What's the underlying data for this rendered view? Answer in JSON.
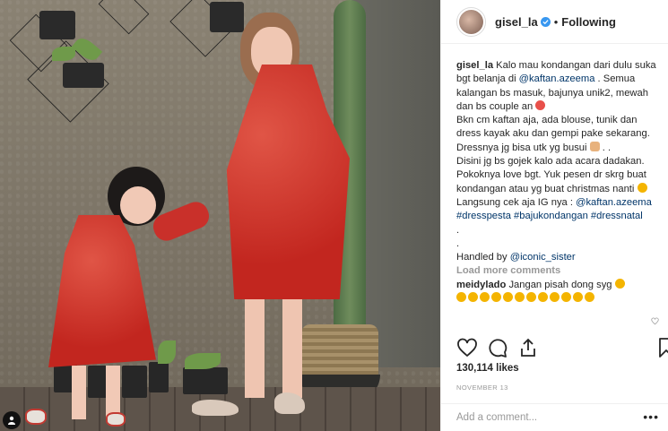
{
  "header": {
    "username": "gisel_la",
    "dot": "•",
    "follow_status": "Following"
  },
  "caption": {
    "author": "gisel_la",
    "line1": "Kalo mau kondangan dari dulu suka bgt belanja di",
    "mention1": "@kaftan.azeema",
    "line1_end": ".",
    "line2": "Semua kalangan bs masuk, bajunya unik2, mewah dan bs couple an",
    "line3": "Bkn cm kaftan aja, ada blouse, tunik dan dress kayak aku dan gempi pake sekarang.",
    "line4": "Dressnya jg bisa utk yg busui",
    "line4_end": ". .",
    "line5": "Disini jg bs gojek kalo ada acara dadakan.",
    "line6": "Pokoknya love bgt. Yuk pesen dr skrg buat kondangan atau yg buat christmas nanti",
    "line7": "Langsung cek aja IG nya :",
    "mention2": "@kaftan.azeema",
    "hashtags": "#dresspesta #bajukondangan #dressnatal",
    "sep1": ".",
    "sep2": ".",
    "handled_prefix": "Handled by",
    "mention3": "@iconic_sister"
  },
  "load_more": "Load more comments",
  "reply": {
    "author": "meidylado",
    "text": "Jangan pisah dong syg"
  },
  "likes": "130,114 likes",
  "date": "NOVEMBER 13",
  "add_comment_placeholder": "Add a comment...",
  "more_options": "•••",
  "icons": {
    "like": "heart-icon",
    "comment": "comment-icon",
    "share": "share-icon",
    "save": "bookmark-icon",
    "verified": "verified-badge-icon",
    "tag": "user-tag-icon"
  },
  "colors": {
    "link": "#003569",
    "verified": "#3897f0",
    "muted": "#999999",
    "text": "#262626"
  }
}
